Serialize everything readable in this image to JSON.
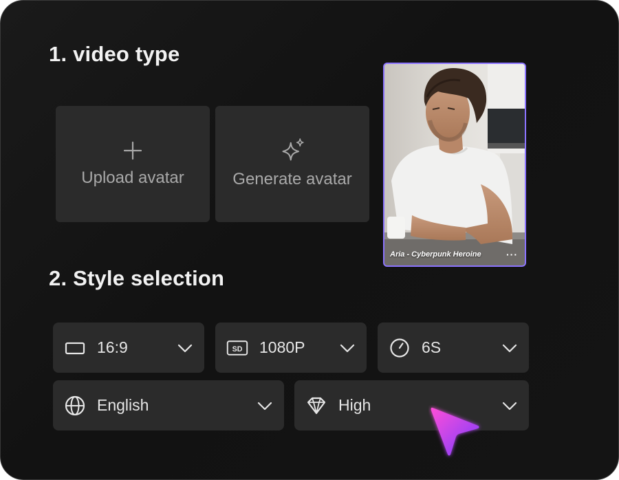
{
  "sections": {
    "video_type_title": "1. video type",
    "style_selection_title": "2. Style selection"
  },
  "avatar_options": {
    "upload": {
      "label": "Upload avatar",
      "icon": "plus-icon"
    },
    "generate": {
      "label": "Generate avatar",
      "icon": "sparkle-icon"
    }
  },
  "selected_avatar": {
    "caption": "Aria - Cyberpunk Heroine",
    "more": "···",
    "border_color": "#8b73ff"
  },
  "style": {
    "aspect_ratio": {
      "value": "16:9",
      "icon": "aspect-ratio-icon"
    },
    "resolution": {
      "value": "1080P",
      "icon": "sd-icon"
    },
    "duration": {
      "value": "6S",
      "icon": "timer-icon"
    },
    "language": {
      "value": "English",
      "icon": "globe-icon"
    },
    "quality": {
      "value": "High",
      "icon": "diamond-icon"
    }
  },
  "colors": {
    "background": "#141414",
    "card": "#2b2b2b",
    "accent": "#8b73ff",
    "cursor_gradient_start": "#ff4fd8",
    "cursor_gradient_end": "#7b3bff"
  }
}
